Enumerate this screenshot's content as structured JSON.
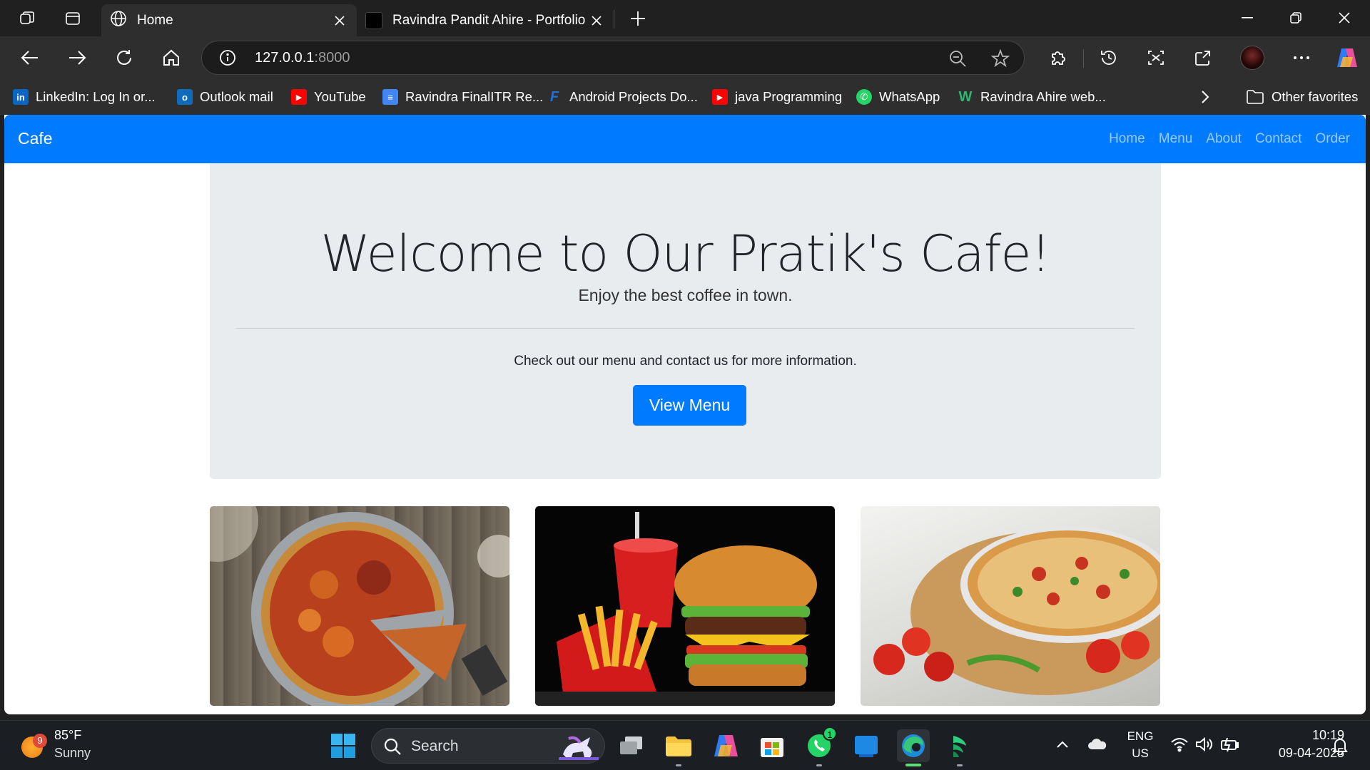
{
  "browser": {
    "tabs": [
      {
        "title": "Home",
        "active": true
      },
      {
        "title": "Ravindra Pandit Ahire - Portfolio",
        "active": false
      }
    ],
    "address": {
      "host": "127.0.0.1",
      "port": ":8000"
    },
    "favorites": [
      {
        "label": "LinkedIn: Log In or...",
        "icon": "linkedin-icon"
      },
      {
        "label": "Outlook mail",
        "icon": "outlook-icon"
      },
      {
        "label": "YouTube",
        "icon": "youtube-icon"
      },
      {
        "label": "Ravindra FinalITR Re...",
        "icon": "docs-icon"
      },
      {
        "label": "Android Projects Do...",
        "icon": "android-projects-icon"
      },
      {
        "label": "java Programming",
        "icon": "youtube-icon"
      },
      {
        "label": "WhatsApp",
        "icon": "whatsapp-icon"
      },
      {
        "label": "Ravindra Ahire web...",
        "icon": "web-icon"
      }
    ],
    "other_favorites": "Other favorites"
  },
  "site": {
    "brand": "Cafe",
    "nav": [
      "Home",
      "Menu",
      "About",
      "Contact",
      "Order"
    ],
    "hero": {
      "title": "Welcome to Our Pratik's Cafe!",
      "lead": "Enjoy the best coffee in town.",
      "info": "Check out our menu and contact us for more information.",
      "button": "View Menu"
    },
    "cards": [
      {
        "image": "pizza-slice-image"
      },
      {
        "image": "burger-fries-image"
      },
      {
        "image": "pizza-tomatoes-image"
      }
    ]
  },
  "taskbar": {
    "weather": {
      "temp": "85°F",
      "condition": "Sunny",
      "badge": "9"
    },
    "search_label": "Search",
    "whatsapp_badge": "1",
    "lang_top": "ENG",
    "lang_bottom": "US",
    "time": "10:19",
    "date": "09-04-2025"
  },
  "colors": {
    "accent": "#007bff",
    "jumbotron": "#e9ecef",
    "chrome": "#202020"
  }
}
